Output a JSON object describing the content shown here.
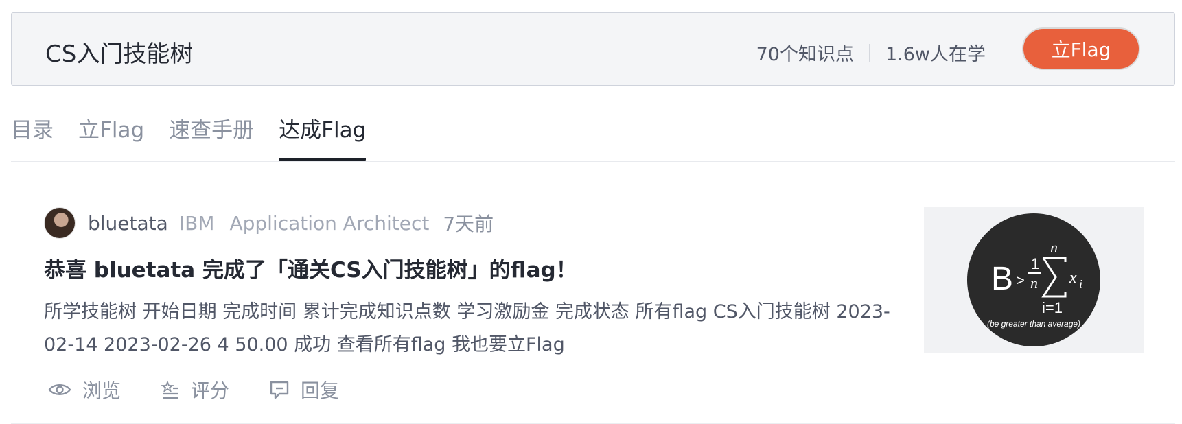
{
  "header": {
    "title": "CS入门技能树",
    "knowledge_points": "70个知识点",
    "learners": "1.6w人在学",
    "flag_button": "立Flag"
  },
  "tabs": [
    {
      "label": "目录"
    },
    {
      "label": "立Flag"
    },
    {
      "label": "速查手册"
    },
    {
      "label": "达成Flag",
      "active": true
    }
  ],
  "post": {
    "username": "bluetata",
    "company": "IBM",
    "position": "Application Architect",
    "time": "7天前",
    "title": "恭喜 bluetata 完成了「通关CS入门技能树」的flag！",
    "body": "所学技能树 开始日期 完成时间 累计完成知识点数 学习激励金 完成状态 所有flag CS入门技能树 2023-02-14 2023-02-26 4 50.00 成功 查看所有flag 我也要立Flag",
    "thumbnail": {
      "main_text": "B",
      "gt": ">",
      "frac_num": "1",
      "frac_den": "n",
      "sum_top": "n",
      "sum_bottom": "i=1",
      "var": "x",
      "sub": "i",
      "caption": "(be greater than average)"
    }
  },
  "actions": [
    {
      "label": "浏览",
      "icon": "eye-icon"
    },
    {
      "label": "评分",
      "icon": "rating-icon"
    },
    {
      "label": "回复",
      "icon": "comment-icon"
    }
  ],
  "colors": {
    "accent": "#e8603c",
    "active_tab_underline": "#1d2129",
    "header_bg": "#f4f5f7"
  }
}
